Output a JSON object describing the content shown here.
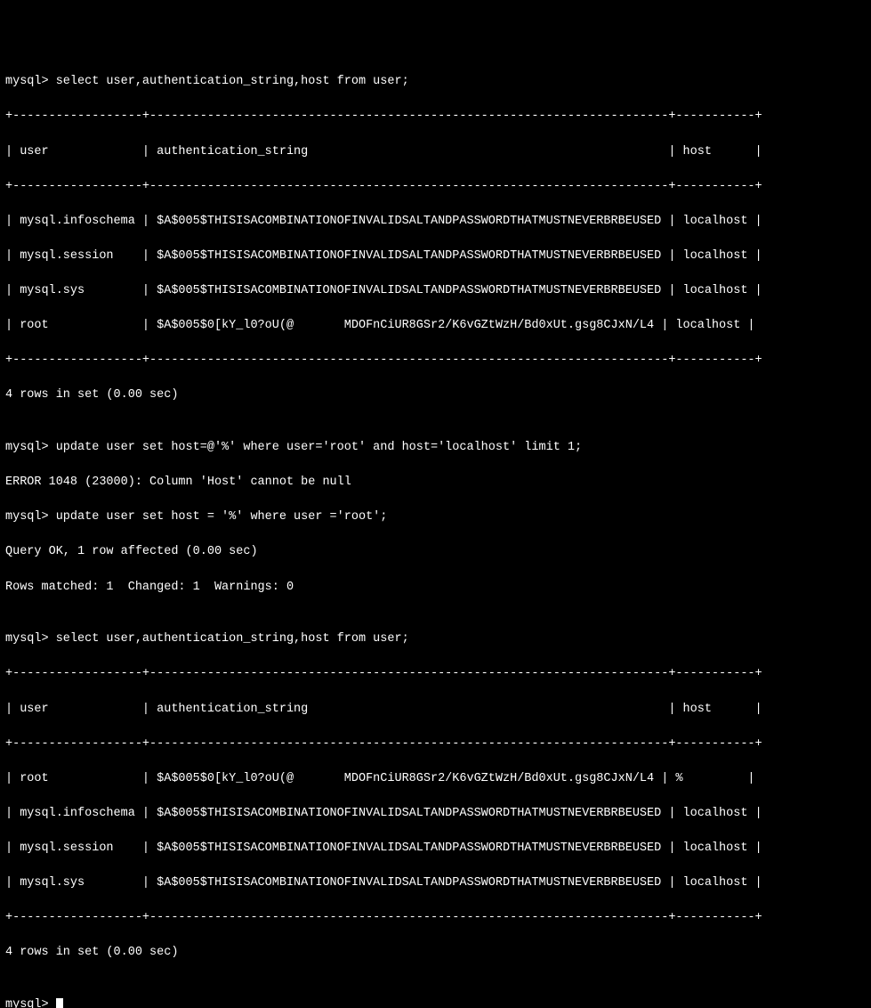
{
  "lines": {
    "l0": "mysql> select user,authentication_string,host from user;",
    "l1": "+------------------+------------------------------------------------------------------------+-----------+",
    "l2": "| user             | authentication_string                                                  | host      |",
    "l3": "+------------------+------------------------------------------------------------------------+-----------+",
    "l4": "| mysql.infoschema | $A$005$THISISACOMBINATIONOFINVALIDSALTANDPASSWORDTHATMUSTNEVERBRBEUSED | localhost |",
    "l5": "| mysql.session    | $A$005$THISISACOMBINATIONOFINVALIDSALTANDPASSWORDTHATMUSTNEVERBRBEUSED | localhost |",
    "l6": "| mysql.sys        | $A$005$THISISACOMBINATIONOFINVALIDSALTANDPASSWORDTHATMUSTNEVERBRBEUSED | localhost |",
    "l7": "| root             | $A$005$0[kY_l0?oU(@       MDOFnCiUR8GSr2/K6vGZtWzH/Bd0xUt.gsg8CJxN/L4 | localhost |",
    "l8": "+------------------+------------------------------------------------------------------------+-----------+",
    "l9": "4 rows in set (0.00 sec)",
    "l10": "",
    "l11": "mysql> update user set host=@'%' where user='root' and host='localhost' limit 1;",
    "l12": "ERROR 1048 (23000): Column 'Host' cannot be null",
    "l13": "mysql> update user set host = '%' where user ='root';",
    "l14": "Query OK, 1 row affected (0.00 sec)",
    "l15": "Rows matched: 1  Changed: 1  Warnings: 0",
    "l16": "",
    "l17": "mysql> select user,authentication_string,host from user;",
    "l18": "+------------------+------------------------------------------------------------------------+-----------+",
    "l19": "| user             | authentication_string                                                  | host      |",
    "l20": "+------------------+------------------------------------------------------------------------+-----------+",
    "l21": "| root             | $A$005$0[kY_l0?oU(@       MDOFnCiUR8GSr2/K6vGZtWzH/Bd0xUt.gsg8CJxN/L4 | %         |",
    "l22": "| mysql.infoschema | $A$005$THISISACOMBINATIONOFINVALIDSALTANDPASSWORDTHATMUSTNEVERBRBEUSED | localhost |",
    "l23": "| mysql.session    | $A$005$THISISACOMBINATIONOFINVALIDSALTANDPASSWORDTHATMUSTNEVERBRBEUSED | localhost |",
    "l24": "| mysql.sys        | $A$005$THISISACOMBINATIONOFINVALIDSALTANDPASSWORDTHATMUSTNEVERBRBEUSED | localhost |",
    "l25": "+------------------+------------------------------------------------------------------------+-----------+",
    "l26": "4 rows in set (0.00 sec)",
    "l27": "",
    "l28": "mysql> "
  },
  "chart_data": {
    "type": "table",
    "queries": [
      {
        "sql": "select user,authentication_string,host from user;",
        "columns": [
          "user",
          "authentication_string",
          "host"
        ],
        "rows": [
          [
            "mysql.infoschema",
            "$A$005$THISISACOMBINATIONOFINVALIDSALTANDPASSWORDTHATMUSTNEVERBRBEUSED",
            "localhost"
          ],
          [
            "mysql.session",
            "$A$005$THISISACOMBINATIONOFINVALIDSALTANDPASSWORDTHATMUSTNEVERBRBEUSED",
            "localhost"
          ],
          [
            "mysql.sys",
            "$A$005$THISISACOMBINATIONOFINVALIDSALTANDPASSWORDTHATMUSTNEVERBRBEUSED",
            "localhost"
          ],
          [
            "root",
            "$A$005$0[kY_l0?oU(@       MDOFnCiUR8GSr2/K6vGZtWzH/Bd0xUt.gsg8CJxN/L4",
            "localhost"
          ]
        ],
        "status": "4 rows in set (0.00 sec)"
      },
      {
        "sql": "update user set host=@'%' where user='root' and host='localhost' limit 1;",
        "error": "ERROR 1048 (23000): Column 'Host' cannot be null"
      },
      {
        "sql": "update user set host = '%' where user ='root';",
        "status": "Query OK, 1 row affected (0.00 sec)",
        "info": "Rows matched: 1  Changed: 1  Warnings: 0"
      },
      {
        "sql": "select user,authentication_string,host from user;",
        "columns": [
          "user",
          "authentication_string",
          "host"
        ],
        "rows": [
          [
            "root",
            "$A$005$0[kY_l0?oU(@       MDOFnCiUR8GSr2/K6vGZtWzH/Bd0xUt.gsg8CJxN/L4",
            "%"
          ],
          [
            "mysql.infoschema",
            "$A$005$THISISACOMBINATIONOFINVALIDSALTANDPASSWORDTHATMUSTNEVERBRBEUSED",
            "localhost"
          ],
          [
            "mysql.session",
            "$A$005$THISISACOMBINATIONOFINVALIDSALTANDPASSWORDTHATMUSTNEVERBRBEUSED",
            "localhost"
          ],
          [
            "mysql.sys",
            "$A$005$THISISACOMBINATIONOFINVALIDSALTANDPASSWORDTHATMUSTNEVERBRBEUSED",
            "localhost"
          ]
        ],
        "status": "4 rows in set (0.00 sec)"
      }
    ]
  }
}
